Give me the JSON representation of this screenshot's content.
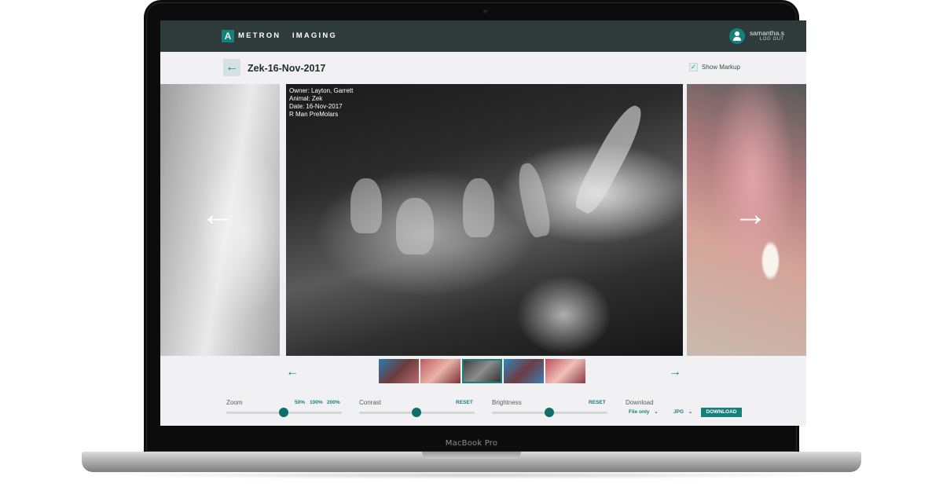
{
  "app": {
    "logo_mark": "A",
    "logo_word_1": "METRON",
    "logo_word_2": "IMAGING",
    "user_name": "samantha.s",
    "logout_label": "LOG OUT"
  },
  "page": {
    "back_icon": "←",
    "title": "Zek-16-Nov-2017",
    "show_markup_label": "Show Markup",
    "show_markup_checked": true
  },
  "image": {
    "caption_owner": "Owner: Layton, Garrett",
    "caption_animal": "Animal: Zek",
    "caption_date": "Date: 16-Nov-2017",
    "caption_view": "R Man PreMolars"
  },
  "nav": {
    "prev_icon": "←",
    "next_icon": "→",
    "thumb_prev_icon": "←",
    "thumb_next_icon": "→"
  },
  "thumbnails": [
    "thumb-1",
    "thumb-2",
    "thumb-3",
    "thumb-4",
    "thumb-5"
  ],
  "controls": {
    "zoom_label": "Zoom",
    "zoom_presets": [
      "50%",
      "100%",
      "200%"
    ],
    "zoom_value": 0.5,
    "contrast_label": "Conrast",
    "contrast_reset": "RESET",
    "contrast_value": 0.5,
    "brightness_label": "Brightness",
    "brightness_reset": "RESET",
    "brightness_value": 0.5,
    "download_label": "Download",
    "file_select": "File only",
    "format_select": "JPG",
    "chevron": "⌄",
    "download_button": "DOWNLOAD"
  },
  "device": {
    "brand": "MacBook Pro"
  },
  "colors": {
    "accent": "#16807a",
    "topbar": "#2f3a3b"
  }
}
